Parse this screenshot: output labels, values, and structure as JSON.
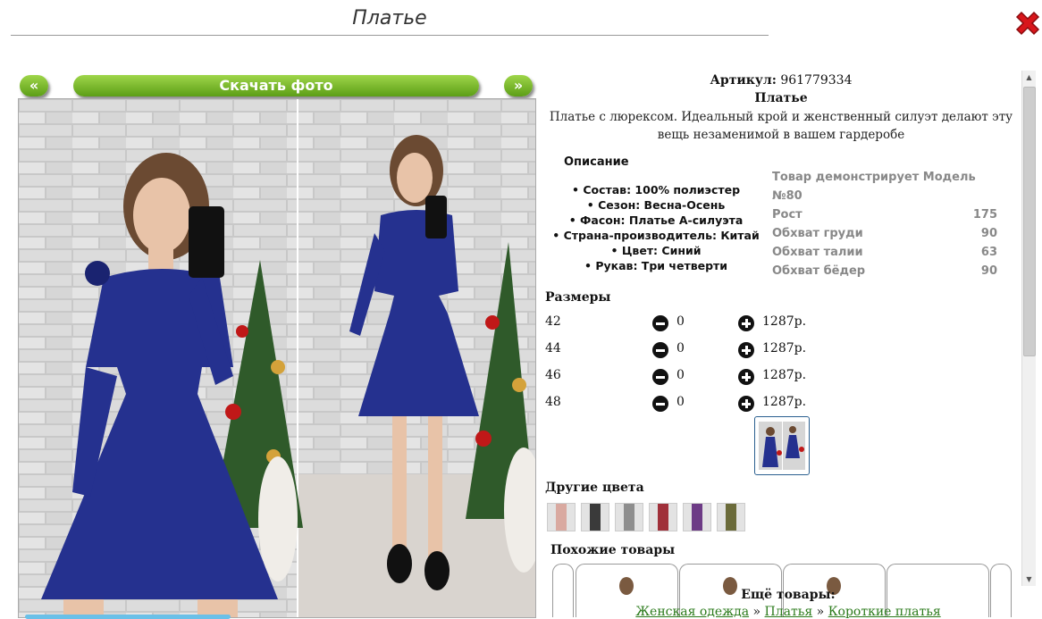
{
  "header": {
    "title": "Платье"
  },
  "photo_nav": {
    "prev": "«",
    "download": "Скачать фото",
    "next": "»"
  },
  "product": {
    "article_label": "Артикул:",
    "article_value": "961779334",
    "name": "Платье",
    "description": "Платье с люрексом. Идеальный крой и женственный силуэт делают эту вещь незаменимой в вашем гардеробе"
  },
  "description_section": {
    "heading": "Описание",
    "properties": [
      "Состав: 100% полиэстер",
      "Сезон: Весна-Осень",
      "Фасон: Платье А-силуэта",
      "Страна-производитель: Китай",
      "Цвет: Синий",
      "Рукав: Три четверти"
    ]
  },
  "model": {
    "heading": "Товар демонстрирует Модель №80",
    "rows": [
      {
        "label": "Рост",
        "value": "175"
      },
      {
        "label": "Обхват груди",
        "value": "90"
      },
      {
        "label": "Обхват талии",
        "value": "63"
      },
      {
        "label": "Обхват бёдер",
        "value": "90"
      }
    ]
  },
  "sizes": {
    "heading": "Размеры",
    "rows": [
      {
        "size": "42",
        "qty": "0",
        "price": "1287р."
      },
      {
        "size": "44",
        "qty": "0",
        "price": "1287р."
      },
      {
        "size": "46",
        "qty": "0",
        "price": "1287р."
      },
      {
        "size": "48",
        "qty": "0",
        "price": "1287р."
      }
    ]
  },
  "other_colors": {
    "heading": "Другие цвета"
  },
  "similar": {
    "heading": "Похожие товары"
  },
  "footer": {
    "more_label": "Ещё товары:",
    "crumbs": [
      "Женская одежда",
      "Платья",
      "Короткие платья"
    ],
    "separator": "»"
  },
  "colors": {
    "accent_green": "#6bb01f",
    "dress_blue": "#25318f",
    "link_green": "#2a7a1a",
    "close_red": "#d8161b",
    "swatches": [
      "#d9a9a0",
      "#3a3a3a",
      "#8e8e8e",
      "#a0303a",
      "#6d3b86",
      "#6b6b3a"
    ]
  }
}
